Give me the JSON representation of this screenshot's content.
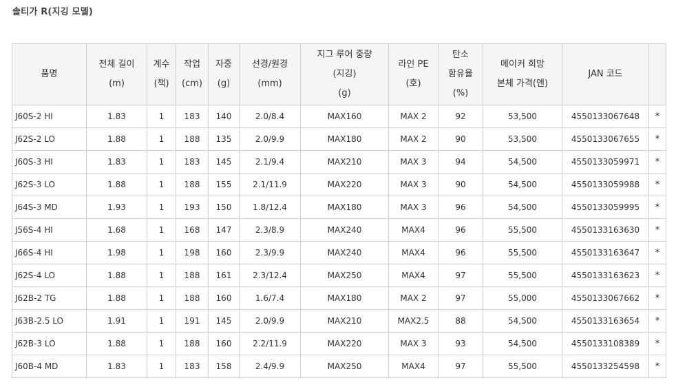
{
  "page": {
    "title": "솔티가 R(지깅 모델)"
  },
  "table": {
    "headers": [
      {
        "lines": [
          "품명"
        ]
      },
      {
        "lines": [
          "전체 길이",
          "(m)"
        ]
      },
      {
        "lines": [
          "계수",
          "(책)"
        ]
      },
      {
        "lines": [
          "작업",
          "(cm)"
        ]
      },
      {
        "lines": [
          "자중",
          "(g)"
        ]
      },
      {
        "lines": [
          "선경/원경",
          "(mm)"
        ]
      },
      {
        "lines": [
          "지그 루어 중량",
          "(지깅)",
          "(g)"
        ]
      },
      {
        "lines": [
          "라인 PE",
          "(호)"
        ]
      },
      {
        "lines": [
          "탄소",
          "함유율",
          "(%)"
        ]
      },
      {
        "lines": [
          "메이커 희망",
          "본체 가격(엔)"
        ]
      },
      {
        "lines": [
          "JAN 코드"
        ]
      },
      {
        "lines": [
          ""
        ]
      }
    ],
    "rows": [
      [
        "J60S-2 HI",
        "1.83",
        "1",
        "183",
        "140",
        "2.0/8.4",
        "MAX160",
        "MAX 2",
        "92",
        "53,500",
        "4550133067648",
        "*"
      ],
      [
        "J62S-2 LO",
        "1.88",
        "1",
        "188",
        "135",
        "2.0/9.9",
        "MAX180",
        "MAX 2",
        "90",
        "53,500",
        "4550133067655",
        "*"
      ],
      [
        "J60S-3 HI",
        "1.83",
        "1",
        "183",
        "145",
        "2.1/9.4",
        "MAX210",
        "MAX 3",
        "94",
        "54,500",
        "4550133059971",
        "*"
      ],
      [
        "J62S-3 LO",
        "1.88",
        "1",
        "188",
        "155",
        "2.1/11.9",
        "MAX220",
        "MAX 3",
        "90",
        "54,500",
        "4550133059988",
        "*"
      ],
      [
        "J64S-3 MD",
        "1.93",
        "1",
        "193",
        "150",
        "1.8/12.4",
        "MAX180",
        "MAX 3",
        "96",
        "54,500",
        "4550133059995",
        "*"
      ],
      [
        "J56S-4 HI",
        "1.68",
        "1",
        "168",
        "147",
        "2.3/8.9",
        "MAX240",
        "MAX4",
        "96",
        "55,500",
        "4550133163630",
        "*"
      ],
      [
        "J66S-4 HI",
        "1.98",
        "1",
        "198",
        "160",
        "2.3/9.9",
        "MAX240",
        "MAX4",
        "96",
        "55,500",
        "4550133163647",
        "*"
      ],
      [
        "J62S-4 LO",
        "1.88",
        "1",
        "188",
        "161",
        "2.3/12.4",
        "MAX250",
        "MAX4",
        "97",
        "55,500",
        "4550133163623",
        "*"
      ],
      [
        "J62B-2 TG",
        "1.88",
        "1",
        "188",
        "160",
        "1.6/7.4",
        "MAX180",
        "MAX 2",
        "97",
        "55,000",
        "4550133067662",
        "*"
      ],
      [
        "J63B-2.5 LO",
        "1.91",
        "1",
        "191",
        "145",
        "2.0/9.9",
        "MAX210",
        "MAX2.5",
        "88",
        "54,500",
        "4550133163654",
        "*"
      ],
      [
        "J62B-3 LO",
        "1.88",
        "1",
        "188",
        "160",
        "2.2/11.9",
        "MAX220",
        "MAX 3",
        "93",
        "54,500",
        "4550133108389",
        "*"
      ],
      [
        "J60B-4 MD",
        "1.83",
        "1",
        "183",
        "158",
        "2.4/9.9",
        "MAX250",
        "MAX4",
        "97",
        "55,500",
        "4550133254598",
        "*"
      ]
    ]
  }
}
